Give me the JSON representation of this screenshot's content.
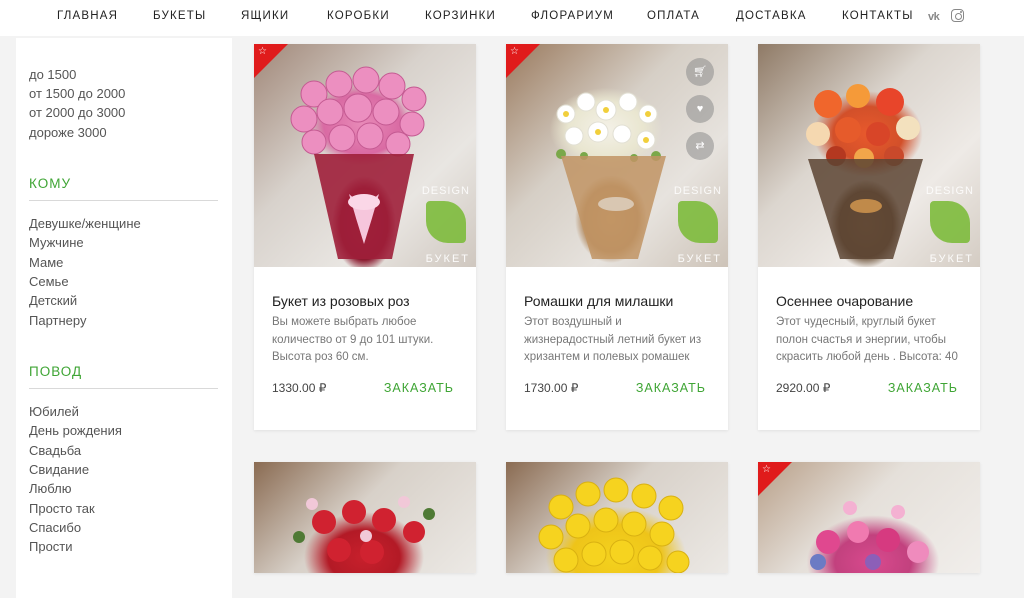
{
  "nav": {
    "items": [
      "ГЛАВНАЯ",
      "БУКЕТЫ",
      "ЯЩИКИ",
      "КОРОБКИ",
      "КОРЗИНКИ",
      "ФЛОРАРИУМ",
      "ОПЛАТА",
      "ДОСТАВКА",
      "КОНТАКТЫ"
    ],
    "vk_label": "vk"
  },
  "sidebar": {
    "prices": [
      "до 1500",
      "от 1500 до 2000",
      "от 2000 до 3000",
      "дороже 3000"
    ],
    "whom_heading": "КОМУ",
    "whom": [
      "Девушке/женщине",
      "Мужчине",
      "Маме",
      "Семье",
      "Детский",
      "Партнеру"
    ],
    "occasion_heading": "ПОВОД",
    "occasion": [
      "Юбилей",
      "День рождения",
      "Свадьба",
      "Свидание",
      "Люблю",
      "Просто так",
      "Спасибо",
      "Прости"
    ]
  },
  "watermark": {
    "design": "DESIGN",
    "buket": "БУКЕТ"
  },
  "products": [
    {
      "title": "Букет из розовых роз",
      "desc": "Вы можете выбрать любое количество от 9 до 101 штуки. Высота роз 60 см.",
      "price": "1330.00 ₽",
      "order": "ЗАКАЗАТЬ"
    },
    {
      "title": "Ромашки для милашки",
      "desc": "Этот воздушный и жизнерадостный летний букет из хризантем и полевых ромашек",
      "price": "1730.00 ₽",
      "order": "ЗАКАЗАТЬ"
    },
    {
      "title": "Осеннее очарование",
      "desc": "Этот чудесный, круглый букет полон счастья и энергии, чтобы скрасить любой день . Высота: 40",
      "price": "2920.00 ₽",
      "order": "ЗАКАЗАТЬ"
    }
  ],
  "colors": {
    "accent": "#3fa535",
    "badge": "#e01b1b"
  }
}
